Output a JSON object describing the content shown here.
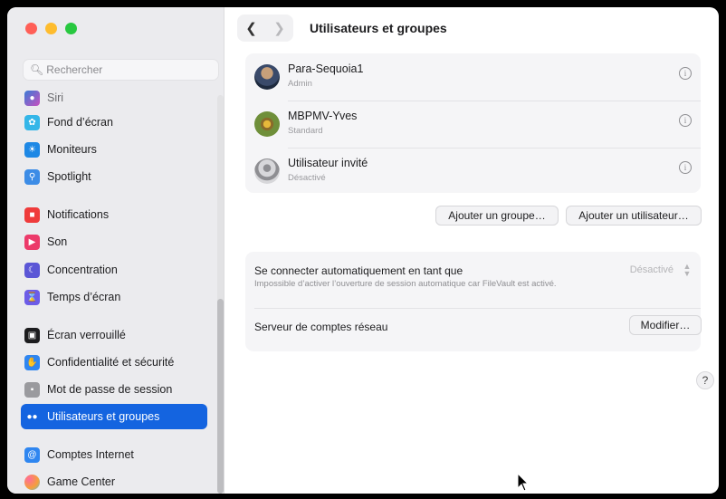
{
  "window": {
    "title": "Utilisateurs et groupes"
  },
  "search": {
    "placeholder": "Rechercher"
  },
  "sidebar": {
    "items": [
      {
        "label": "Siri",
        "icon": "siri-icon",
        "color": "#9b4dca"
      },
      {
        "label": "Fond d’écran",
        "icon": "wallpaper-icon",
        "color": "#34b6e8"
      },
      {
        "label": "Moniteurs",
        "icon": "display-icon",
        "color": "#1e88e5"
      },
      {
        "label": "Spotlight",
        "icon": "spotlight-icon",
        "color": "#3c8ce6"
      },
      {
        "label": "Notifications",
        "icon": "notifications-icon",
        "color": "#ef3b3b"
      },
      {
        "label": "Son",
        "icon": "sound-icon",
        "color": "#ec3a6a"
      },
      {
        "label": "Concentration",
        "icon": "focus-icon",
        "color": "#5b56d6"
      },
      {
        "label": "Temps d’écran",
        "icon": "screen-time-icon",
        "color": "#6c5ce7"
      },
      {
        "label": "Écran verrouillé",
        "icon": "lock-screen-icon",
        "color": "#1c1c1e"
      },
      {
        "label": "Confidentialité et sécurité",
        "icon": "privacy-hand-icon",
        "color": "#2f86f0"
      },
      {
        "label": "Mot de passe de session",
        "icon": "password-icon",
        "color": "#9a9a9e"
      },
      {
        "label": "Utilisateurs et groupes",
        "icon": "users-icon",
        "color": "#2f86f0"
      },
      {
        "label": "Comptes Internet",
        "icon": "at-icon",
        "color": "#2f86f0"
      },
      {
        "label": "Game Center",
        "icon": "game-center-icon",
        "color": "#f4a03a"
      }
    ]
  },
  "users": [
    {
      "name": "Para-Sequoia1",
      "role": "Admin"
    },
    {
      "name": "MBPMV-Yves",
      "role": "Standard"
    },
    {
      "name": "Utilisateur invité",
      "role": "Désactivé"
    }
  ],
  "buttons": {
    "add_group": "Ajouter un groupe…",
    "add_user": "Ajouter un utilisateur…",
    "modify": "Modifier…",
    "help": "?"
  },
  "autologin": {
    "title": "Se connecter automatiquement en tant que",
    "description": "Impossible d’activer l’ouverture de session automatique car FileVault est activé.",
    "value": "Désactivé"
  },
  "network": {
    "label": "Serveur de comptes réseau"
  },
  "colors": {
    "accent": "#1464e0"
  }
}
